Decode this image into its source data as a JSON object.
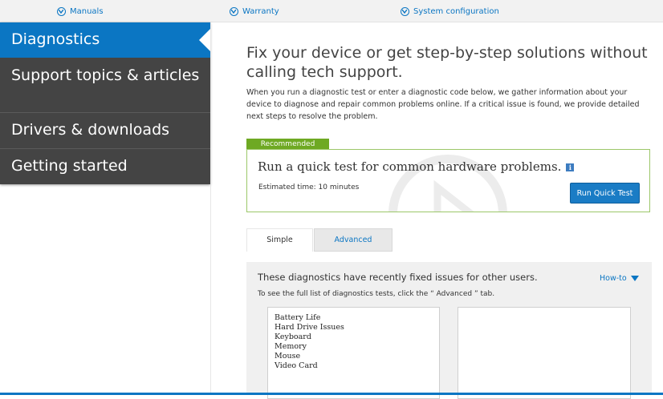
{
  "topnav": {
    "items": [
      {
        "label": "Manuals"
      },
      {
        "label": "Warranty"
      },
      {
        "label": "System configuration"
      }
    ]
  },
  "sidebar": {
    "items": [
      {
        "label": "Diagnostics",
        "active": true
      },
      {
        "label": "Support topics & articles"
      },
      {
        "label": "Drivers & downloads"
      },
      {
        "label": "Getting started"
      }
    ]
  },
  "main": {
    "headline": "Fix your device or get step-by-step solutions without calling tech support.",
    "intro": "When you run a diagnostic test or enter a diagnostic code below, we gather information about your device to diagnose and repair common problems online. If a critical issue is found, we provide detailed next steps to resolve the problem."
  },
  "recommended": {
    "tag": "Recommended",
    "title": "Run a quick test for common hardware problems.",
    "info_icon_glyph": "i",
    "estimate": "Estimated time: 10 minutes",
    "button": "Run Quick Test"
  },
  "tabs": [
    {
      "label": "Simple",
      "active": true
    },
    {
      "label": "Advanced"
    }
  ],
  "panel": {
    "title": "These diagnostics have recently fixed issues for other users.",
    "howto": "How-to",
    "subtitle": "To see the full list of diagnostics tests, click the “ Advanced ” tab.",
    "list": [
      "Battery Life",
      "Hard Drive Issues",
      "Keyboard",
      "Memory",
      "Mouse",
      "Video Card"
    ]
  },
  "colors": {
    "brand_blue": "#0b76c3",
    "recommended_green": "#6ea923",
    "sidebar_dark": "#444444"
  }
}
